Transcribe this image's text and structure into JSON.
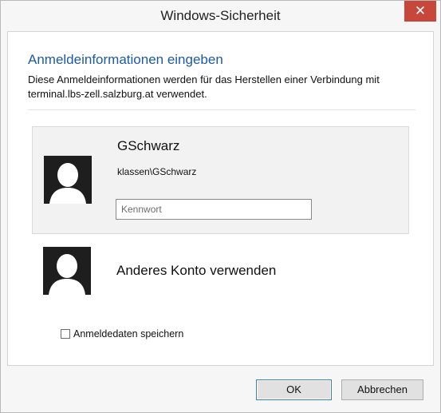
{
  "window": {
    "title": "Windows-Sicherheit",
    "close_symbol": "✕"
  },
  "header": {
    "heading": "Anmeldeinformationen eingeben",
    "description": "Diese Anmeldeinformationen werden für das Herstellen einer Verbindung mit terminal.lbs-zell.salzburg.at verwendet."
  },
  "account": {
    "name": "GSchwarz",
    "domain_user": "klassen\\GSchwarz",
    "password_placeholder": "Kennwort",
    "password_value": "",
    "avatar_icon": "user-silhouette-icon"
  },
  "other_account": {
    "label": "Anderes Konto verwenden",
    "avatar_icon": "user-silhouette-icon"
  },
  "remember": {
    "label": "Anmeldedaten speichern",
    "checked": false
  },
  "buttons": {
    "ok": "OK",
    "cancel": "Abbrechen"
  },
  "colors": {
    "heading": "#1c5aa5",
    "close_button": "#c7473b",
    "avatar_bg": "#1e1e1e",
    "ok_border": "#3c7fb1"
  }
}
